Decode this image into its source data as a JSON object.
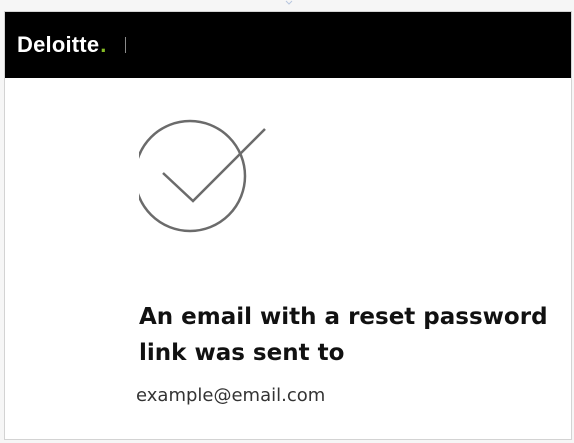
{
  "header": {
    "brand": "Deloitte",
    "brand_dot": ".",
    "brand_color": "#000000",
    "brand_accent": "#86bc25"
  },
  "content": {
    "status_icon": "checkmark-circle-icon",
    "message": "An email with a reset password link was sent to",
    "email": "example@email.com"
  }
}
